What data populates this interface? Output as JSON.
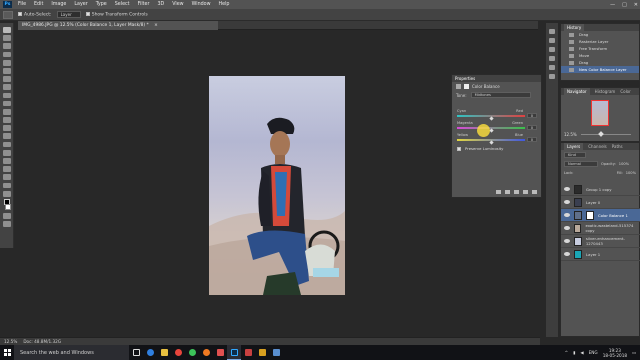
{
  "app": {
    "logo": "Ps",
    "menu": [
      "File",
      "Edit",
      "Image",
      "Layer",
      "Type",
      "Select",
      "Filter",
      "3D",
      "View",
      "Window",
      "Help"
    ],
    "window_controls": [
      "—",
      "□",
      "✕"
    ]
  },
  "options": {
    "auto_select_label": "Auto-Select:",
    "auto_select_value": "Layer",
    "show_transform_label": "Show Transform Controls"
  },
  "document": {
    "tab_title": "IMG_4986.JPG @ 12.5% (Color Balance 1, Layer Mask/8) *",
    "close": "×"
  },
  "status": {
    "zoom": "12.5%",
    "doc_size": "Doc: 48.8M/1.32G"
  },
  "history": {
    "tab": "History",
    "items": [
      "Drag",
      "Rasterize Layer",
      "Free Transform",
      "Move",
      "Drag",
      "New Color Balance Layer"
    ],
    "selected_index": 5
  },
  "navigator": {
    "tabs": [
      "Navigator",
      "Histogram",
      "Color"
    ],
    "zoom": "12.5%"
  },
  "properties": {
    "title": "Properties",
    "adjustment": "Color Balance",
    "tone_label": "Tone:",
    "tone_value": "Midtones",
    "sliders": [
      {
        "left": "Cyan",
        "right": "Red",
        "value": "0",
        "colors": [
          "#2ec4c4",
          "#e04040"
        ],
        "pos": 0.5
      },
      {
        "left": "Magenta",
        "right": "Green",
        "value": "0",
        "colors": [
          "#d64ad6",
          "#39c14a"
        ],
        "pos": 0.5
      },
      {
        "left": "Yellow",
        "right": "Blue",
        "value": "0",
        "colors": [
          "#e2d640",
          "#4058e0"
        ],
        "pos": 0.5
      }
    ],
    "preserve_label": "Preserve Luminosity"
  },
  "layers": {
    "tabs": [
      "Layers",
      "Channels",
      "Paths"
    ],
    "filter_label": "Kind",
    "blend_mode": "Normal",
    "opacity_label": "Opacity:",
    "opacity_value": "100%",
    "lock_label": "Lock:",
    "fill_label": "Fill:",
    "fill_value": "100%",
    "items": [
      {
        "name": "Group 1 copy",
        "thumb": "#2b2b2b",
        "selected": false
      },
      {
        "name": "Layer 0",
        "thumb": "#3a3f50",
        "selected": false
      },
      {
        "name": "Color Balance 1",
        "thumb": "#ffffff",
        "selected": true
      },
      {
        "name": "exotic-wasteland-515374 copy",
        "thumb": "#b9a99b",
        "selected": false
      },
      {
        "name": "silver-enhancement-1270443",
        "thumb": "#c8cde0",
        "selected": false
      },
      {
        "name": "Layer 1",
        "thumb": "#1aa6b5",
        "selected": false
      }
    ]
  },
  "taskbar": {
    "search_placeholder": "Search the web and Windows",
    "time": "19:23",
    "date": "18-05-2018",
    "lang": "ENG"
  },
  "colors": {
    "accent": "#4a6896",
    "panel": "#535353",
    "canvas_bg": "#282828"
  }
}
